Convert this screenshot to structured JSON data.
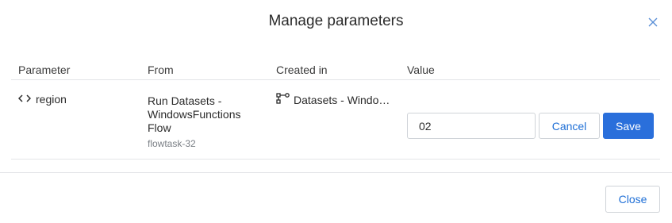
{
  "dialog": {
    "title": "Manage parameters",
    "close_icon": "close-icon",
    "accent_color": "#2a6fdb"
  },
  "table": {
    "columns": [
      "Parameter",
      "From",
      "Created in",
      "Value"
    ],
    "rows": [
      {
        "parameter": "region",
        "parameter_icon": "code-brackets-icon",
        "from_title": "Run Datasets - WindowsFunctions Flow",
        "from_sub": "flowtask-32",
        "created_in": "Datasets - Window…",
        "created_icon": "flow-icon",
        "value": "02",
        "cancel_label": "Cancel",
        "save_label": "Save"
      }
    ]
  },
  "footer": {
    "close_label": "Close"
  }
}
